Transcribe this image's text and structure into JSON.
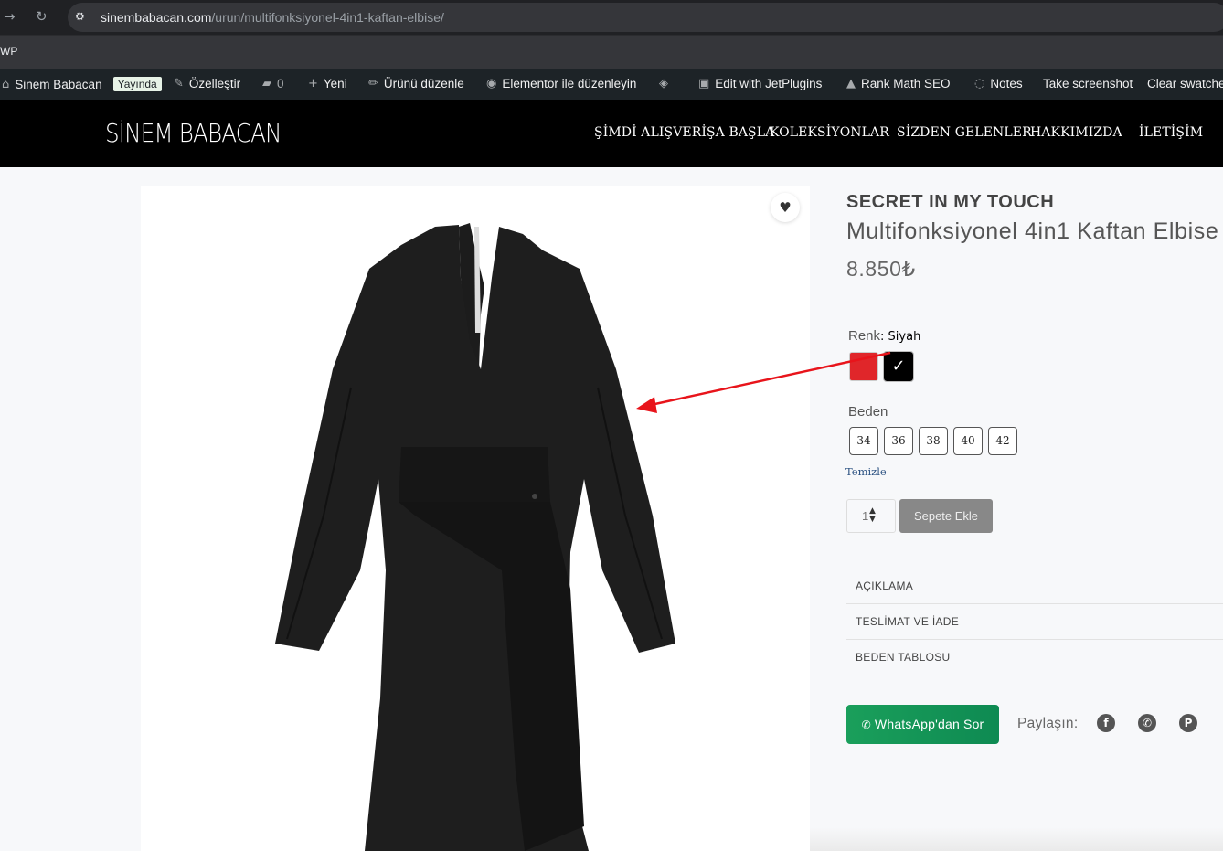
{
  "browser": {
    "url_host": "sinembabacan.com",
    "url_path": "/urun/multifonksiyonel-4in1-kaftan-elbise/",
    "bookmark": "WP"
  },
  "admin_bar": {
    "site": "Sinem Babacan",
    "status_badge": "Yayında",
    "customize": "Özelleştir",
    "comments_count": "0",
    "new": "Yeni",
    "edit_product": "Ürünü düzenle",
    "elementor": "Elementor ile düzenleyin",
    "jetplugins": "Edit with JetPlugins",
    "rankmath": "Rank Math SEO",
    "notes": "Notes",
    "screenshot": "Take screenshot",
    "clear_swatches": "Clear swatche"
  },
  "header": {
    "logo": "SİNEM BABACAN",
    "menu": [
      "ŞİMDİ ALIŞVERİŞA BAŞLA",
      "KOLEKSİYONLAR",
      "SİZDEN GELENLER",
      "HAKKIMIZDA",
      "İLETİŞİM"
    ]
  },
  "product": {
    "brand": "SECRET IN MY TOUCH",
    "title": "Multifonksiyonel 4in1 Kaftan Elbise",
    "price": "8.850₺",
    "color_label": "Renk",
    "color_value": ": Siyah",
    "swatches": [
      {
        "name": "Kırmızı",
        "color": "#e0262a"
      },
      {
        "name": "Siyah",
        "color": "#000000"
      }
    ],
    "size_label": "Beden",
    "sizes": [
      "34",
      "36",
      "38",
      "40",
      "42"
    ],
    "clear": "Temizle",
    "qty": "1",
    "add_to_cart": "Sepete Ekle",
    "tabs": [
      "AÇIKLAMA",
      "TESLİMAT VE İADE",
      "BEDEN TABLOSU"
    ],
    "whatsapp": "WhatsApp'dan Sor",
    "share_label": "Paylaşın:",
    "share_icons": [
      "facebook-icon",
      "whatsapp-icon",
      "pinterest-icon"
    ]
  },
  "colors": {
    "header_bg": "#000000",
    "admin_bar_bg": "#1d2327",
    "whatsapp_green": "#1a9f5b",
    "annotation_arrow": "#e8141b"
  }
}
